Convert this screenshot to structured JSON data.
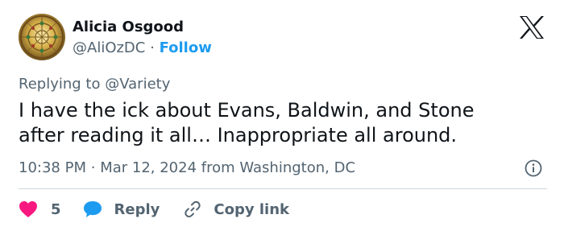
{
  "author": {
    "name": "Alicia Osgood",
    "handle": "@AliOzDC",
    "separator": "·",
    "follow_label": "Follow"
  },
  "reply_context": {
    "prefix": "Replying to",
    "handle": "@Variety"
  },
  "tweet": {
    "line1": "I have the ick about Evans, Baldwin, and Stone",
    "line2": "after reading it all… Inappropriate all around."
  },
  "meta": {
    "time": "10:38 PM",
    "separator": "·",
    "date": "Mar 12, 2024",
    "location": "from Washington, DC"
  },
  "actions": {
    "like_count": "5",
    "reply_label": "Reply",
    "copy_link_label": "Copy link"
  },
  "icons": {
    "brand": "x-logo-icon",
    "info": "info-icon",
    "like": "heart-icon",
    "reply": "speech-bubble-icon",
    "copy": "link-icon"
  },
  "colors": {
    "text_primary": "#0f1419",
    "text_secondary": "#536471",
    "accent_blue": "#1d9bf0",
    "like_pink": "#f91880",
    "divider": "#cfd9de"
  }
}
